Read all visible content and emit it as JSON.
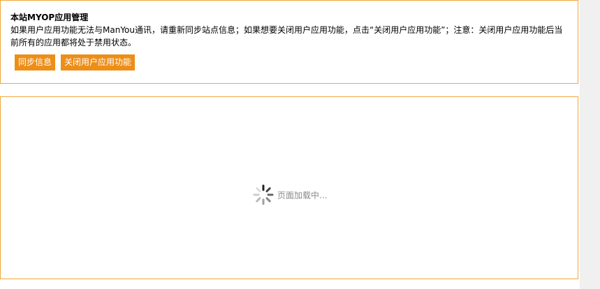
{
  "myop": {
    "title": "本站MYOP应用管理",
    "description": "如果用户应用功能无法与ManYou通讯，请重新同步站点信息；如果想要关闭用户应用功能，点击“关闭用户应用功能”；注意：关闭用户应用功能后当前所有的应用都将处于禁用状态。",
    "sync_button": "同步信息",
    "close_button": "关闭用户应用功能"
  },
  "loader": {
    "text": "页面加载中...",
    "icon": "spinner-icon"
  },
  "colors": {
    "accent": "#ed8e17",
    "border": "#f0a83c",
    "loading_text": "#8a8a8a"
  }
}
